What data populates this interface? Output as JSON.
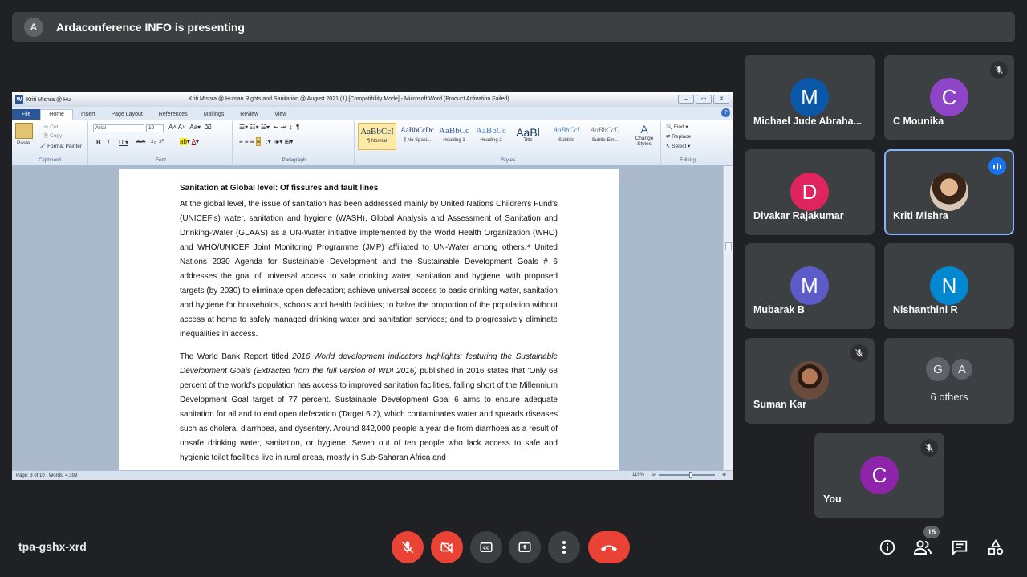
{
  "banner": {
    "avatar_letter": "A",
    "text": "Ardaconference INFO is presenting"
  },
  "word": {
    "tab_title": "Kriti Mishra @ Hu",
    "window_title": "Kriti Mishra @ Human Rights and Sanitation @ August 2021 (1) [Compatibility Mode] - Microsoft Word (Product Activation Failed)",
    "tabs": [
      "File",
      "Home",
      "Insert",
      "Page Layout",
      "References",
      "Mailings",
      "Review",
      "View"
    ],
    "clipboard": {
      "paste": "Paste",
      "cut": "Cut",
      "copy": "Copy",
      "format_painter": "Format Painter",
      "label": "Clipboard"
    },
    "font": {
      "name": "Arial",
      "size": "10",
      "label": "Font"
    },
    "paragraph_label": "Paragraph",
    "styles": [
      {
        "preview": "AaBbCcI",
        "name": "¶ Normal"
      },
      {
        "preview": "AaBbCcDc",
        "name": "¶ No Spaci..."
      },
      {
        "preview": "AaBbCc",
        "name": "Heading 1"
      },
      {
        "preview": "AaBbCc",
        "name": "Heading 2"
      },
      {
        "preview": "AaBl",
        "name": "Title"
      },
      {
        "preview": "AaBbCcI",
        "name": "Subtitle"
      },
      {
        "preview": "AaBbCcD",
        "name": "Subtle Em..."
      }
    ],
    "styles_label": "Styles",
    "change_styles": "Change Styles",
    "editing": {
      "find": "Find",
      "replace": "Replace",
      "select": "Select",
      "label": "Editing"
    },
    "doc": {
      "heading": "Sanitation at Global level: Of fissures and fault lines",
      "para1": "At the global level, the issue of sanitation has been addressed mainly by United Nations Children's Fund's (UNICEF's) water, sanitation and hygiene (WASH), Global Analysis and Assessment of Sanitation and Drinking-Water (GLAAS) as a UN-Water initiative implemented by the World Health Organization (WHO) and WHO/UNICEF Joint Monitoring Programme (JMP) affiliated to UN-Water among others.⁴ United Nations 2030 Agenda for Sustainable Development and the Sustainable Development Goals # 6 addresses the goal of universal access to safe drinking water, sanitation and hygiene, with proposed targets (by 2030) to eliminate open defecation; achieve universal access to basic drinking water, sanitation and hygiene for households, schools and health facilities; to halve the proportion of the population without access at home to safely managed drinking water and sanitation services; and to progressively eliminate inequalities in access.",
      "para2_a": "The World Bank Report titled ",
      "para2_italic": "2016 World development indicators highlights: featuring the Sustainable Development Goals (Extracted from the full version of WDI 2016)",
      "para2_b": " published in 2016 states that 'Only 68 percent of the world's population has access to improved sanitation facilities, falling short of the Millennium Development Goal target of 77 percent. Sustainable Development Goal 6 aims to ensure adequate sanitation for all and to end open defecation (Target 6.2), which contaminates water and spreads diseases such as cholera, diarrhoea, and dysentery. Around 842,000 people a year die from diarrhoea as a result of unsafe drinking water, sanitation, or hygiene. Seven out of ten people who lack access to safe and hygienic toilet facilities live in rural areas, mostly in Sub-Saharan Africa and"
    },
    "status": {
      "page": "Page: 3 of 10",
      "words": "Words: 4,399",
      "zoom": "119%"
    }
  },
  "participants": [
    {
      "name": "Michael Jude Abraha...",
      "letter": "M",
      "color": "#0b57a8",
      "muted": false
    },
    {
      "name": "C Mounika",
      "letter": "C",
      "color": "#8e44c7",
      "muted": true
    },
    {
      "name": "Divakar Rajakumar",
      "letter": "D",
      "color": "#e0245e",
      "muted": false
    },
    {
      "name": "Kriti Mishra",
      "letter": "",
      "color": "#b08c6c",
      "muted": false,
      "speaking": true
    },
    {
      "name": "Mubarak B",
      "letter": "M",
      "color": "#5c5bc7",
      "muted": false
    },
    {
      "name": "Nishanthini R",
      "letter": "N",
      "color": "#0288d1",
      "muted": false
    },
    {
      "name": "Suman Kar",
      "letter": "",
      "color": "#7a4b35",
      "muted": true
    },
    {
      "name": "6 others",
      "letters": [
        "G",
        "A"
      ]
    },
    {
      "name": "You",
      "letter": "C",
      "color": "#8e24aa",
      "muted": true
    }
  ],
  "bottom": {
    "meeting_code": "tpa-gshx-xrd",
    "people_count": "15"
  }
}
